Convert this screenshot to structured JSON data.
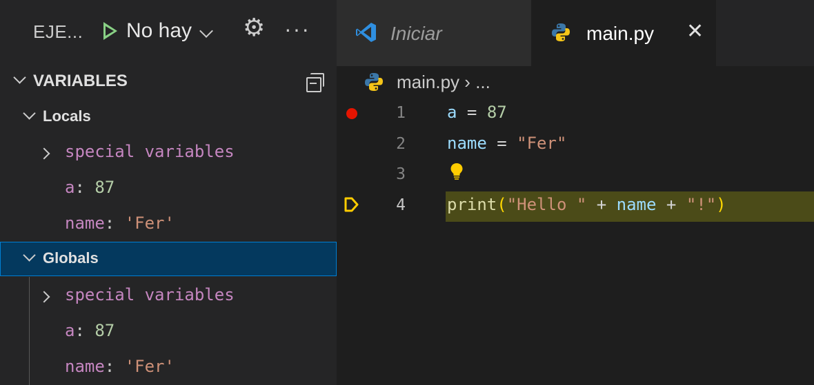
{
  "debug_toolbar": {
    "title": "EJE...",
    "config_name": "No hay",
    "more": "···"
  },
  "variables_panel": {
    "title": "VARIABLES",
    "scopes": [
      {
        "label": "Locals",
        "expanded": true,
        "items": [
          {
            "name": "special variables",
            "expandable": true
          },
          {
            "name": "a",
            "value": "87",
            "kind": "number"
          },
          {
            "name": "name",
            "value": "'Fer'",
            "kind": "string"
          }
        ]
      },
      {
        "label": "Globals",
        "expanded": true,
        "selected": true,
        "items": [
          {
            "name": "special variables",
            "expandable": true
          },
          {
            "name": "a",
            "value": "87",
            "kind": "number"
          },
          {
            "name": "name",
            "value": "'Fer'",
            "kind": "string"
          }
        ]
      }
    ]
  },
  "tabs": [
    {
      "label": "Iniciar",
      "icon": "vscode-icon",
      "active": false,
      "italic": true
    },
    {
      "label": "main.py",
      "icon": "python-icon",
      "active": true,
      "close": "✕"
    }
  ],
  "breadcrumb": {
    "file": "main.py",
    "separator": "›",
    "rest": "..."
  },
  "code_lines": [
    {
      "number": "1",
      "breakpoint": true
    },
    {
      "number": "2"
    },
    {
      "number": "3",
      "lightbulb": true
    },
    {
      "number": "4",
      "current": true
    }
  ],
  "code": {
    "l1": {
      "var": "a",
      "op": " = ",
      "num": "87"
    },
    "l2": {
      "var": "name",
      "op": " = ",
      "str": "\"Fer\""
    },
    "l4": {
      "fn": "print",
      "open": "(",
      "s1": "\"Hello \"",
      "op1": " + ",
      "var": "name",
      "op2": " + ",
      "s2": "\"!\"",
      "close": ")"
    }
  },
  "colors": {
    "breakpoint": "#e51400",
    "current_line": "#4b4b18",
    "stack_frame": "#ffcc00",
    "selection": "#04395e",
    "play": "#89d185"
  }
}
